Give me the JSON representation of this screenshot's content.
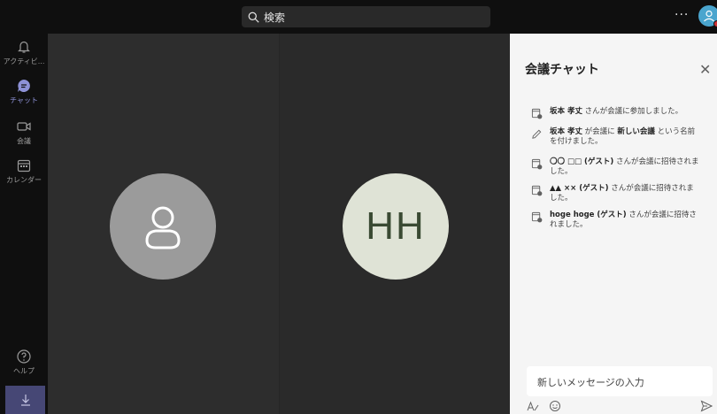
{
  "header": {
    "search_placeholder": "検索",
    "more_label": "···"
  },
  "rail": {
    "items": [
      {
        "label": "アクティビ...",
        "icon": "bell-icon"
      },
      {
        "label": "チャット",
        "icon": "chat-icon"
      },
      {
        "label": "会議",
        "icon": "video-icon"
      },
      {
        "label": "カレンダー",
        "icon": "calendar-icon"
      },
      {
        "label": "ヘルプ",
        "icon": "help-icon"
      }
    ]
  },
  "stage": {
    "participant_initials": "HH"
  },
  "chat": {
    "title": "会議チャット",
    "messages": [
      {
        "icon": "meeting-join-icon",
        "bold": "坂本 孝丈",
        "text": " さんが会議に参加しました。"
      },
      {
        "icon": "pencil-icon",
        "bold": "坂本 孝丈",
        "text_pre": " が会議に ",
        "bold2": "新しい会議",
        "text": " という名前を付けました。"
      },
      {
        "icon": "meeting-join-icon",
        "bold": "〇〇 □□ (ゲスト)",
        "text": " さんが会議に招待されました。"
      },
      {
        "icon": "meeting-join-icon",
        "bold": "▲▲ ×× (ゲスト)",
        "text": " さんが会議に招待されました。"
      },
      {
        "icon": "meeting-join-icon",
        "bold": "hoge hoge (ゲスト)",
        "text": " さんが会議に招待されました。"
      }
    ],
    "compose_placeholder": "新しいメッセージの入力"
  },
  "colors": {
    "accent": "#8d91d6",
    "rail_bg": "#0f0f0f",
    "chat_bg": "#f5f5f5",
    "download_bg": "#464775"
  }
}
